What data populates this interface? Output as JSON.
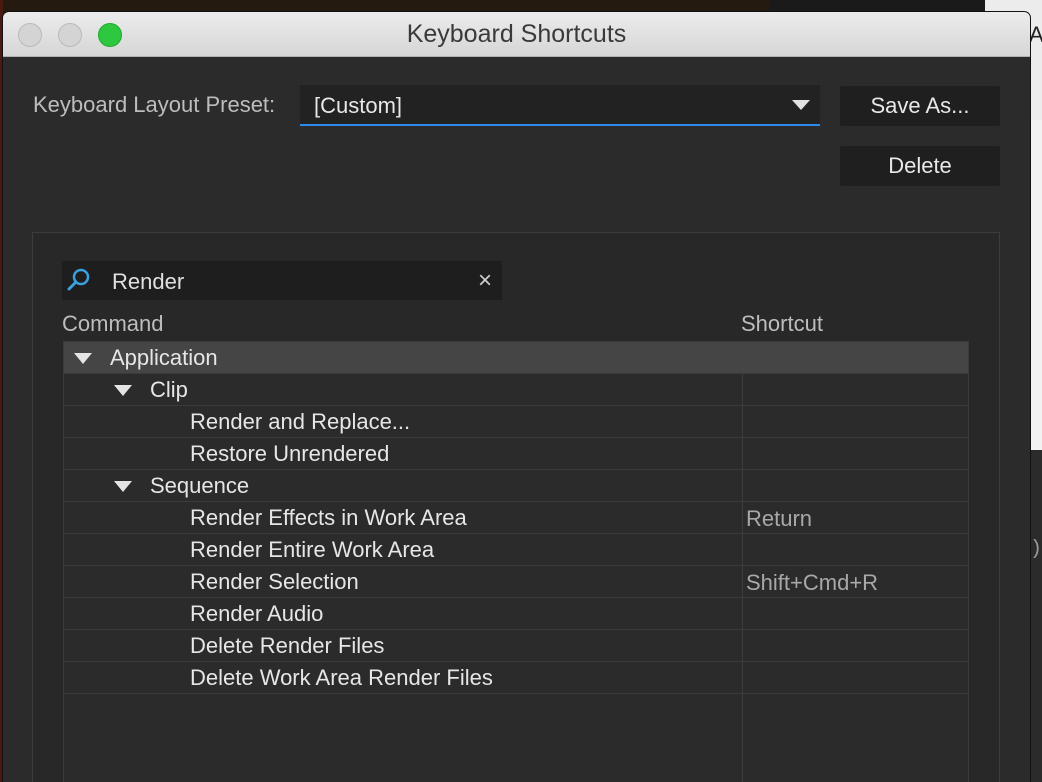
{
  "window": {
    "title": "Keyboard Shortcuts"
  },
  "preset": {
    "label": "Keyboard Layout Preset:",
    "value": "[Custom]"
  },
  "buttons": {
    "save_as": "Save As...",
    "delete": "Delete"
  },
  "search": {
    "value": "Render",
    "clear": "×"
  },
  "columns": {
    "command": "Command",
    "shortcut": "Shortcut"
  },
  "rows": [
    {
      "label": "Application",
      "shortcut": "",
      "level": 0,
      "expanded": true
    },
    {
      "label": "Clip",
      "shortcut": "",
      "level": 1,
      "expanded": true
    },
    {
      "label": "Render and Replace...",
      "shortcut": "",
      "level": 2
    },
    {
      "label": "Restore Unrendered",
      "shortcut": "",
      "level": 2
    },
    {
      "label": "Sequence",
      "shortcut": "",
      "level": 1,
      "expanded": true
    },
    {
      "label": "Render Effects in Work Area",
      "shortcut": "Return",
      "level": 2
    },
    {
      "label": "Render Entire Work Area",
      "shortcut": "",
      "level": 2
    },
    {
      "label": "Render Selection",
      "shortcut": "Shift+Cmd+R",
      "level": 2
    },
    {
      "label": "Render Audio",
      "shortcut": "",
      "level": 2
    },
    {
      "label": "Delete Render Files",
      "shortcut": "",
      "level": 2
    },
    {
      "label": "Delete Work Area Render Files",
      "shortcut": "",
      "level": 2
    }
  ],
  "background": {
    "fragment_top": "Ar",
    "fragment_mid": ");"
  },
  "colors": {
    "accent": "#2d8ceb",
    "zoom_button": "#2ec840",
    "search_icon": "#3aa0e0"
  }
}
